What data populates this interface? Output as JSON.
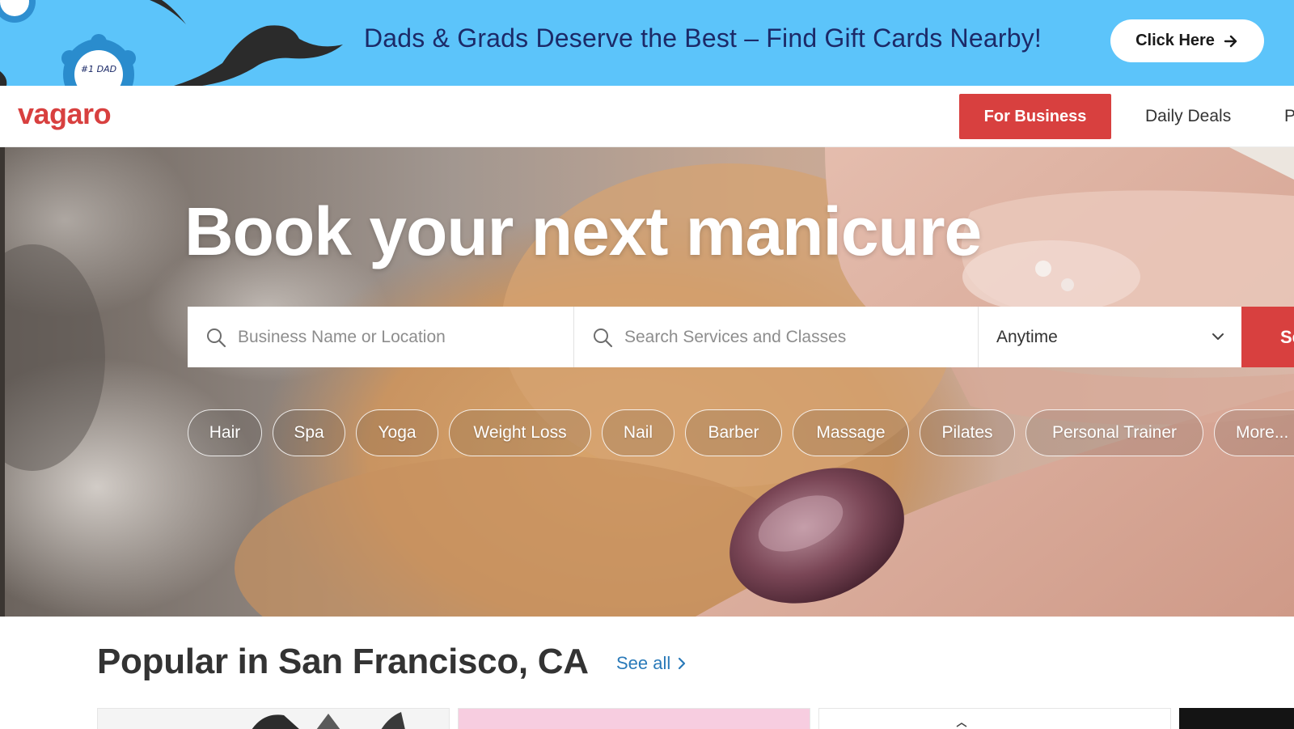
{
  "promo": {
    "badge_text": "#1 DAD",
    "message": "Dads & Grads Deserve the Best – Find Gift Cards Nearby!",
    "cta_label": "Click Here",
    "cta_icon": "arrow-right-icon",
    "background_color": "#5cc4fa",
    "text_color": "#1c2a68"
  },
  "header": {
    "logo": "vagaro",
    "for_business_label": "For Business",
    "nav": [
      "Daily Deals",
      "P"
    ],
    "brand_color": "#d8403f"
  },
  "hero": {
    "title": "Book your next manicure",
    "search": {
      "business_placeholder": "Business Name or Location",
      "services_placeholder": "Search Services and Classes",
      "time_value": "Anytime",
      "search_label": "Search",
      "search_icon": "search-icon",
      "dropdown_icon": "chevron-down-icon"
    },
    "categories": [
      "Hair",
      "Spa",
      "Yoga",
      "Weight Loss",
      "Nail",
      "Barber",
      "Massage",
      "Pilates",
      "Personal Trainer",
      "More..."
    ]
  },
  "popular": {
    "title": "Popular in San Francisco, CA",
    "see_all_label": "See all",
    "see_all_icon": "chevron-right-icon",
    "link_color": "#2a7ab9"
  }
}
